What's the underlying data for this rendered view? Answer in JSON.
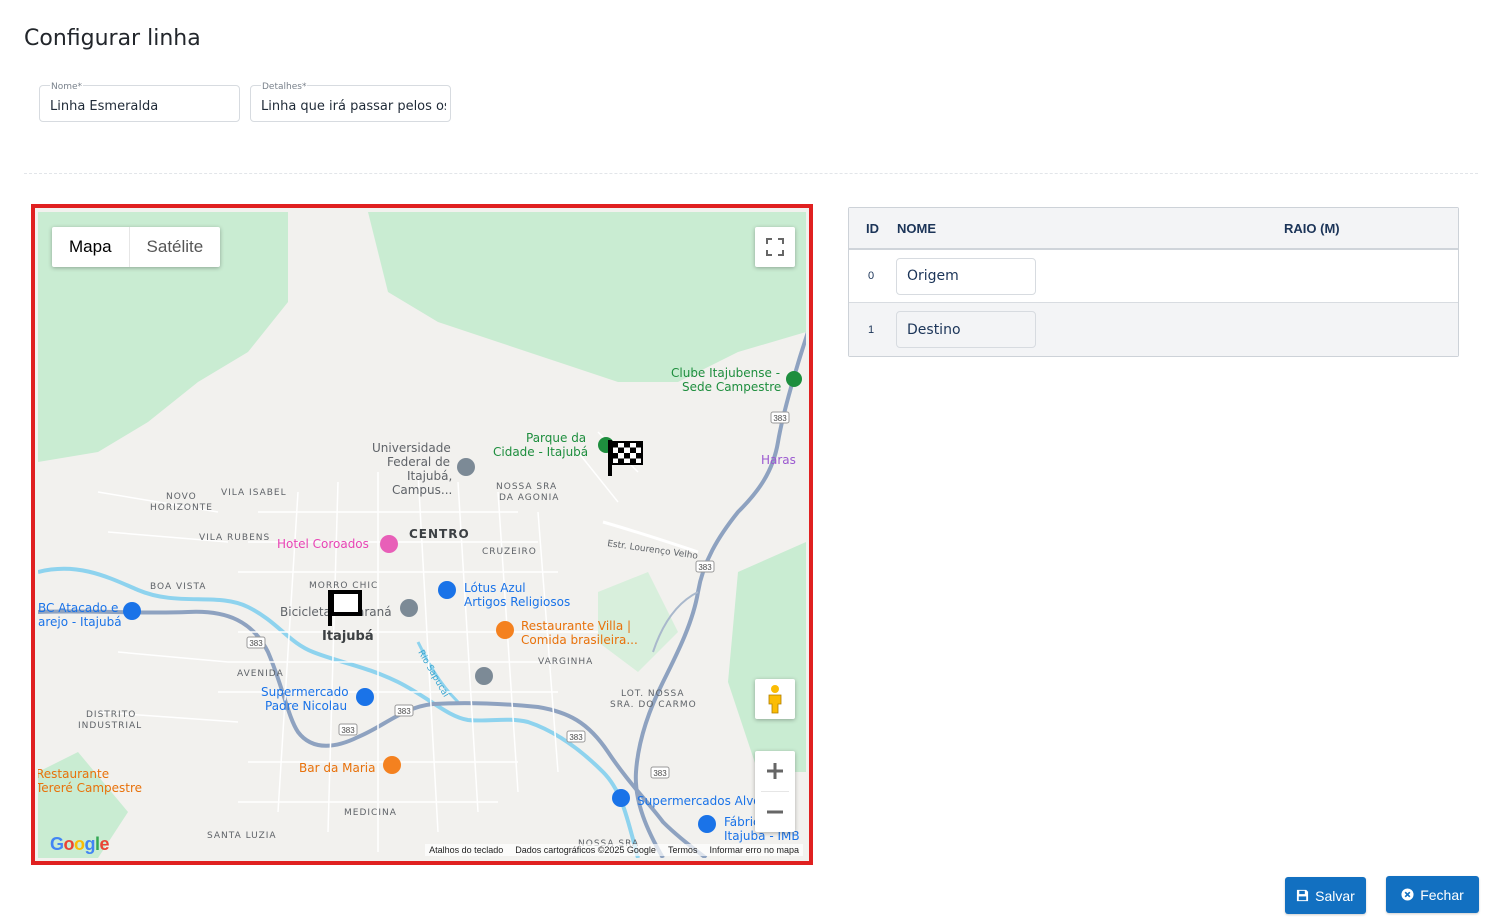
{
  "page": {
    "title": "Configurar linha"
  },
  "form": {
    "nome": {
      "label": "Nome*",
      "value": "Linha Esmeralda"
    },
    "detalhes": {
      "label": "Detalhes*",
      "value": "Linha que irá passar pelos os"
    }
  },
  "map": {
    "type_buttons": {
      "map": "Mapa",
      "satellite": "Satélite"
    },
    "footer": {
      "shortcuts": "Atalhos do teclado",
      "data": "Dados cartográficos ©2025 Google",
      "terms": "Termos",
      "report": "Informar erro no mapa"
    },
    "logo": "Google",
    "labels": {
      "clube1": "Clube Itajubense -",
      "clube2": "Sede Campestre",
      "parque1": "Parque da",
      "parque2": "Cidade - Itajubá",
      "univ1": "Universidade",
      "univ2": "Federal de",
      "univ3": "Itajubá,",
      "univ4": "Campus...",
      "haras": "Haras",
      "novo1": "NOVO",
      "novo2": "HORIZONTE",
      "vila_isabel": "VILA ISABEL",
      "nossa1": "NOSSA SRA",
      "nossa2": "DA AGONIA",
      "centro": "CENTRO",
      "vila_rubens": "VILA RUBENS",
      "hotel": "Hotel Coroados",
      "cruzeiro": "CRUZEIRO",
      "estr": "Estr. Lourenço Velho",
      "boa_vista": "BOA VISTA",
      "morro_chic": "MORRO CHIC",
      "lotus1": "Lótus Azul",
      "lotus2": "Artigos Religiosos",
      "bc1": "BC Atacado e",
      "bc2": "arejo - Itajubá",
      "bicicletaria": "Bicicletaria Paraná",
      "itajuba": "Itajubá",
      "rest_villa1": "Restaurante Villa |",
      "rest_villa2": "Comida brasileira...",
      "rio": "Rio Sapucaí",
      "varginha": "VARGINHA",
      "avenida": "AVENIDA",
      "super1": "Supermercado",
      "super2": "Padre Nicolau",
      "lot1": "LOT. NOSSA",
      "lot2": "SRA. DO CARMO",
      "distrito1": "DISTRITO",
      "distrito2": "INDUSTRIAL",
      "rest_terere1": "Restaurante",
      "rest_terere2": "Tereré Campestre",
      "bar": "Bar da Maria",
      "super_alvorada": "Supermercados Alvorada",
      "fabrica1": "Fábrica",
      "fabrica2": "Itajubá - IMB",
      "medicina": "MEDICINA",
      "santa_luzia": "SANTA LUZIA",
      "nossa_sra_b": "NOSSA SRA",
      "r383": "383"
    }
  },
  "table": {
    "headers": {
      "id": "ID",
      "nome": "NOME",
      "raio": "RAIO (M)"
    },
    "rows": [
      {
        "id": "0",
        "nome": "Origem"
      },
      {
        "id": "1",
        "nome": "Destino"
      }
    ]
  },
  "buttons": {
    "save": "Salvar",
    "close": "Fechar"
  },
  "colors": {
    "primary": "#1270c1",
    "highlight_border": "#e02020",
    "park_green": "#c9ecd2",
    "road": "#8ea2c0",
    "river": "#8ed3ee"
  }
}
